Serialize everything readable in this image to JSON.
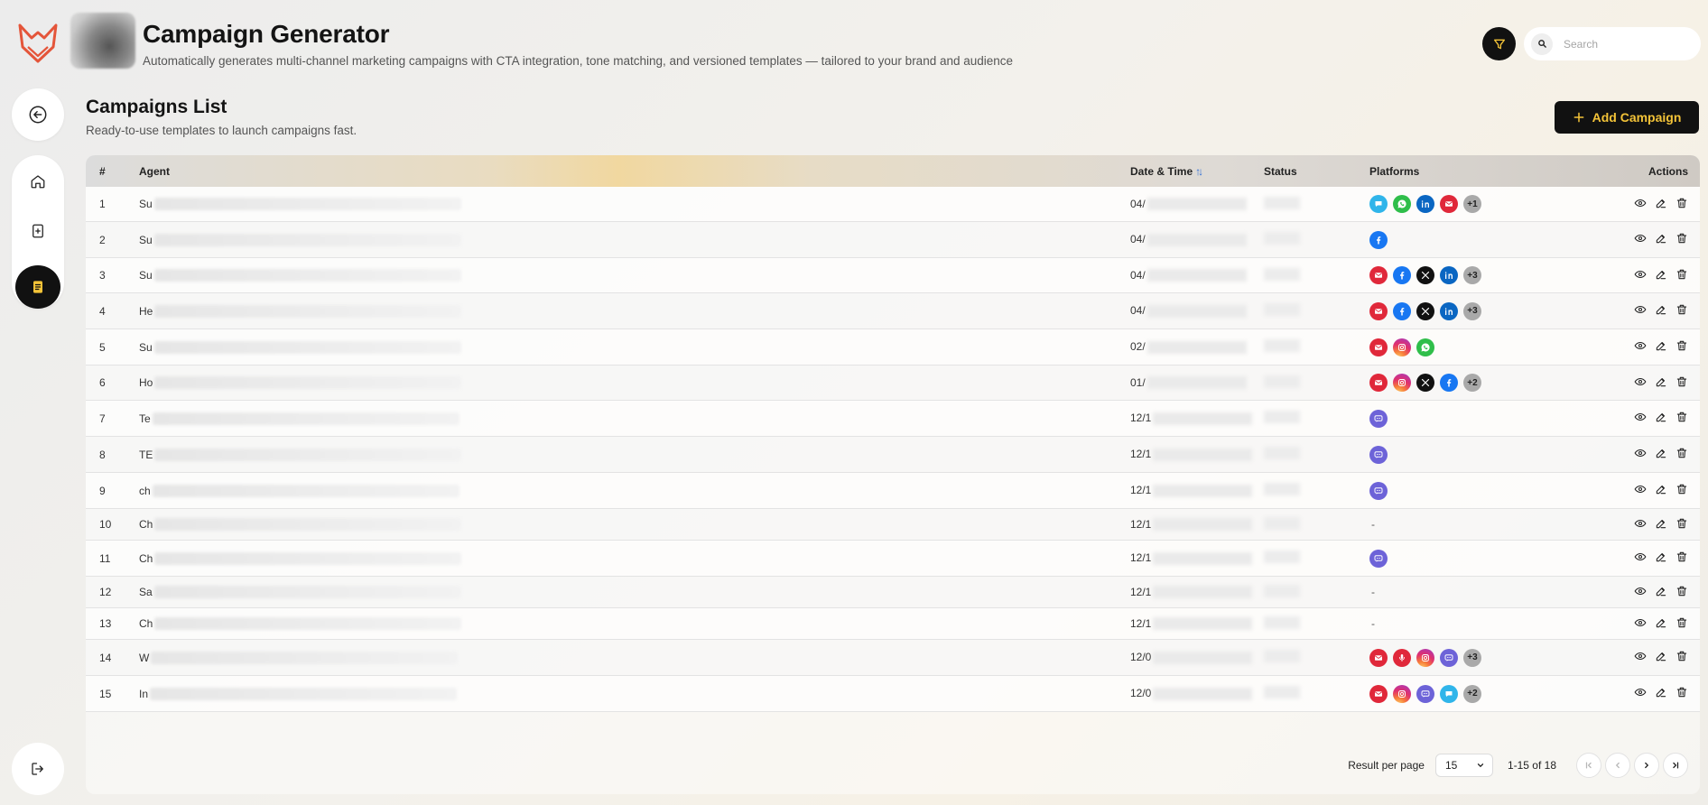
{
  "header": {
    "title": "Campaign Generator",
    "subtitle": "Automatically generates multi-channel marketing campaigns with CTA integration, tone matching, and versioned templates — tailored to your brand and audience"
  },
  "search": {
    "placeholder": "Search"
  },
  "section": {
    "title": "Campaigns List",
    "subtitle": "Ready-to-use templates to launch campaigns fast.",
    "add_label": "Add Campaign"
  },
  "table": {
    "columns": {
      "num": "#",
      "agent": "Agent",
      "date": "Date & Time",
      "status": "Status",
      "platforms": "Platforms",
      "actions": "Actions"
    },
    "rows": [
      {
        "num": "1",
        "agent": "Su",
        "date": "04/",
        "platforms": [
          "sms",
          "whatsapp",
          "linkedin",
          "email"
        ],
        "more": "+1"
      },
      {
        "num": "2",
        "agent": "Su",
        "date": "04/",
        "platforms": [
          "facebook"
        ],
        "more": ""
      },
      {
        "num": "3",
        "agent": "Su",
        "date": "04/",
        "platforms": [
          "email",
          "facebook",
          "x",
          "linkedin"
        ],
        "more": "+3"
      },
      {
        "num": "4",
        "agent": "He",
        "date": "04/",
        "platforms": [
          "email",
          "facebook",
          "x",
          "linkedin"
        ],
        "more": "+3"
      },
      {
        "num": "5",
        "agent": "Su",
        "date": "02/",
        "platforms": [
          "email",
          "instagram",
          "whatsapp"
        ],
        "more": ""
      },
      {
        "num": "6",
        "agent": "Ho",
        "date": "01/",
        "platforms": [
          "email",
          "instagram",
          "x",
          "facebook"
        ],
        "more": "+2"
      },
      {
        "num": "7",
        "agent": "Te",
        "date": "12/1",
        "platforms": [
          "chat"
        ],
        "more": ""
      },
      {
        "num": "8",
        "agent": "TE",
        "date": "12/1",
        "platforms": [
          "chat"
        ],
        "more": ""
      },
      {
        "num": "9",
        "agent": "ch",
        "date": "12/1",
        "platforms": [
          "chat"
        ],
        "more": ""
      },
      {
        "num": "10",
        "agent": "Ch",
        "date": "12/1",
        "platforms": [],
        "more": ""
      },
      {
        "num": "11",
        "agent": "Ch",
        "date": "12/1",
        "platforms": [
          "chat"
        ],
        "more": ""
      },
      {
        "num": "12",
        "agent": "Sa",
        "date": "12/1",
        "platforms": [],
        "more": ""
      },
      {
        "num": "13",
        "agent": "Ch",
        "date": "12/1",
        "platforms": [],
        "more": ""
      },
      {
        "num": "14",
        "agent": "W",
        "date": "12/0",
        "platforms": [
          "email",
          "voice",
          "instagram",
          "chat"
        ],
        "more": "+3"
      },
      {
        "num": "15",
        "agent": "In",
        "date": "12/0",
        "platforms": [
          "email",
          "instagram",
          "chat",
          "sms"
        ],
        "more": "+2"
      }
    ],
    "empty_platform": "-"
  },
  "pagination": {
    "result_per_page_label": "Result per page",
    "per_page": "15",
    "range": "1-15 of 18"
  }
}
